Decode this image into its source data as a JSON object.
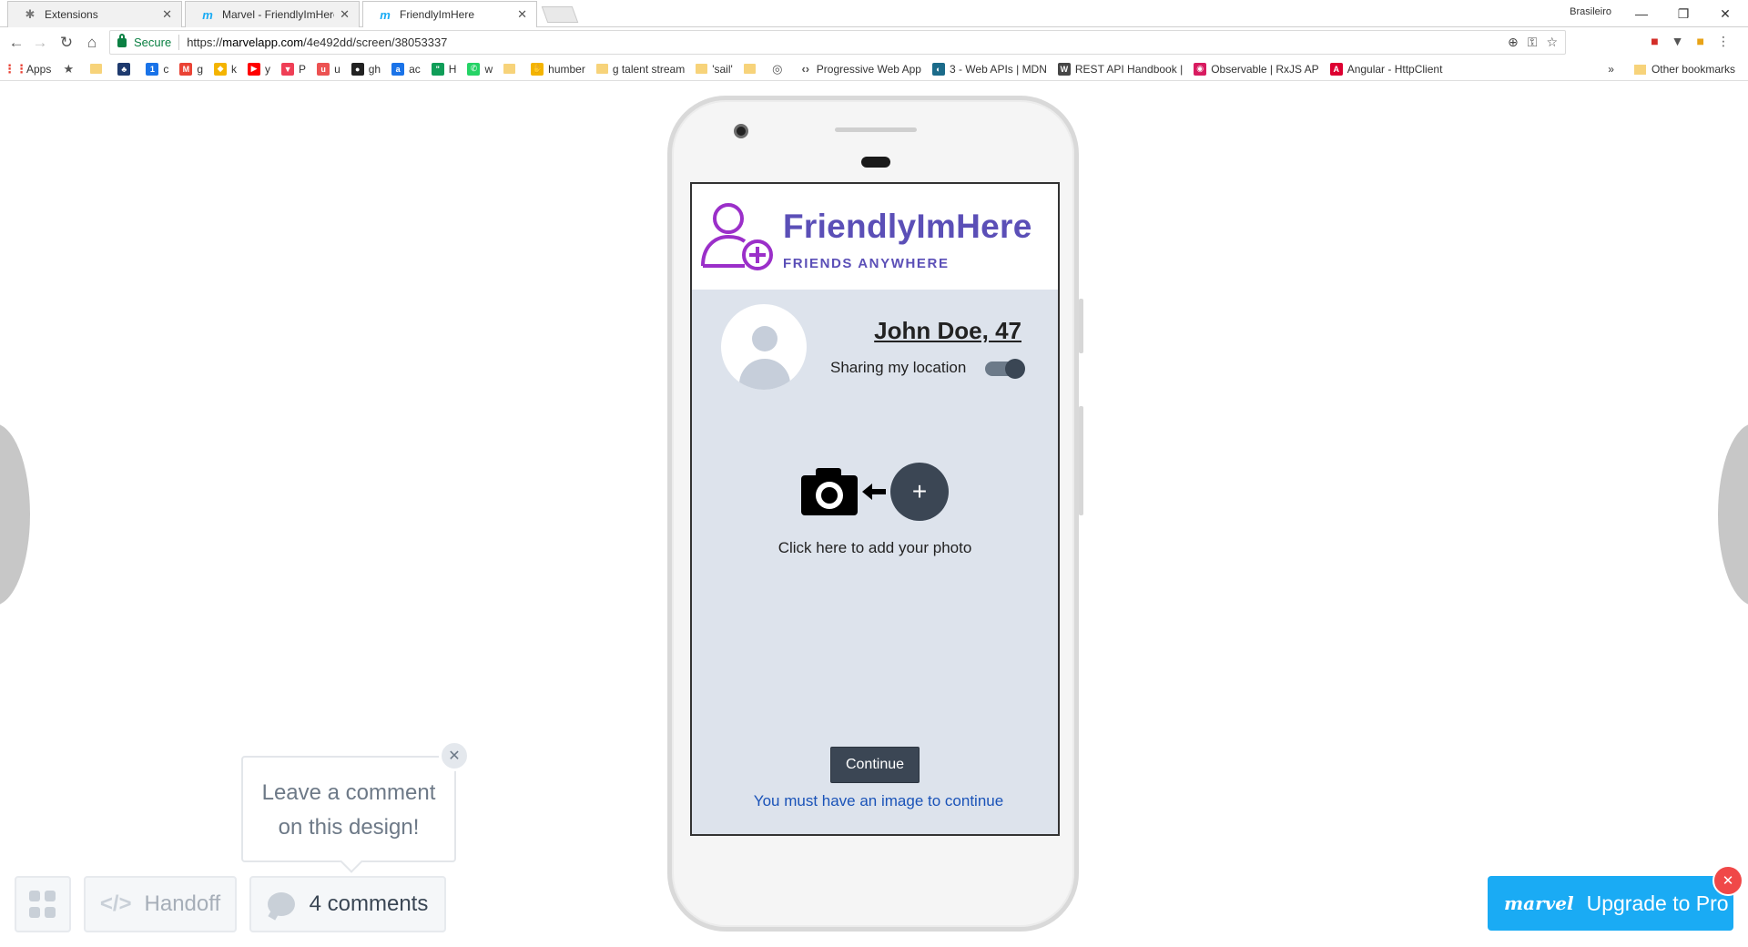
{
  "browser": {
    "tabs": [
      {
        "label": "Extensions",
        "icon": "puzzle-icon"
      },
      {
        "label": "Marvel - FriendlyImHere",
        "icon": "marvel-icon"
      },
      {
        "label": "FriendlyImHere",
        "icon": "marvel-icon"
      }
    ],
    "active_tab": 2,
    "profile": "Brasileiro",
    "secure_label": "Secure",
    "url_scheme": "https://",
    "url_host": "marvelapp.com",
    "url_path": "/4e492dd/screen/38053337",
    "bookmarks": [
      {
        "label": "Apps",
        "icon": "apps-grid-icon",
        "color": "#e94235"
      },
      {
        "label": "",
        "icon": "star-icon",
        "color": "#555555"
      },
      {
        "label": "",
        "icon": "folder-icon",
        "color": "#f7d37a"
      },
      {
        "label": "",
        "icon": "tree-icon",
        "color": "#1e3a6e"
      },
      {
        "label": "c",
        "icon": "calendar-icon",
        "color": "#1a73e8"
      },
      {
        "label": "g",
        "icon": "gmail-icon",
        "color": "#ea4335"
      },
      {
        "label": "k",
        "icon": "keep-icon",
        "color": "#f4b400"
      },
      {
        "label": "y",
        "icon": "youtube-icon",
        "color": "#ff0000"
      },
      {
        "label": "P",
        "icon": "pocket-icon",
        "color": "#ef3f56"
      },
      {
        "label": "u",
        "icon": "udemy-icon",
        "color": "#ec5252"
      },
      {
        "label": "gh",
        "icon": "github-icon",
        "color": "#222222"
      },
      {
        "label": "ac",
        "icon": "ac-icon",
        "color": "#1a73e8"
      },
      {
        "label": "H",
        "icon": "hangouts-icon",
        "color": "#0f9d58"
      },
      {
        "label": "w",
        "icon": "whatsapp-icon",
        "color": "#25d366"
      },
      {
        "label": "",
        "icon": "folder-icon",
        "color": "#f7d37a"
      },
      {
        "label": "humber",
        "icon": "hand-icon",
        "color": "#f4b400"
      },
      {
        "label": "g talent stream",
        "icon": "folder-icon",
        "color": "#f7d37a"
      },
      {
        "label": "'sail'",
        "icon": "folder-icon",
        "color": "#f7d37a"
      },
      {
        "label": "",
        "icon": "folder-icon",
        "color": "#f7d37a"
      },
      {
        "label": "",
        "icon": "globe-icon",
        "color": "#555555"
      },
      {
        "label": "Progressive Web App",
        "icon": "code-icon",
        "color": "#555555"
      },
      {
        "label": "3 - Web APIs | MDN",
        "icon": "mdn-icon",
        "color": "#1b6b8a"
      },
      {
        "label": "REST API Handbook |",
        "icon": "wordpress-icon",
        "color": "#464646"
      },
      {
        "label": "Observable | RxJS AP",
        "icon": "rxjs-icon",
        "color": "#d81b60"
      },
      {
        "label": "Angular - HttpClient",
        "icon": "angular-icon",
        "color": "#dd0031"
      }
    ],
    "more_bookmarks": "»",
    "other_bookmarks": "Other bookmarks"
  },
  "app": {
    "brand": "FriendlyImHere",
    "tagline": "FRIENDS ANYWHERE",
    "user_name": "John Doe, 47",
    "sharing_label": "Sharing my location",
    "sharing_on": true,
    "add_photo_label": "+",
    "add_photo_text": "Click here to add your photo",
    "continue_label": "Continue",
    "warning_text": "You must have an image to continue"
  },
  "marvel": {
    "comment_prompt_line1": "Leave a comment",
    "comment_prompt_line2": "on this design!",
    "handoff_icon": "</>",
    "handoff_label": "Handoff",
    "comments_label": "4 comments",
    "upgrade_logo": "marvel",
    "upgrade_label": "Upgrade to Pro"
  },
  "colors": {
    "brand_purple": "#5b4fb7",
    "logo_magenta": "#9b2fc9",
    "screen_bg": "#dde3ec",
    "dark_button": "#3b4654",
    "link_blue": "#1a53b8",
    "upgrade_blue": "#1aabf4",
    "close_red": "#f04848"
  }
}
